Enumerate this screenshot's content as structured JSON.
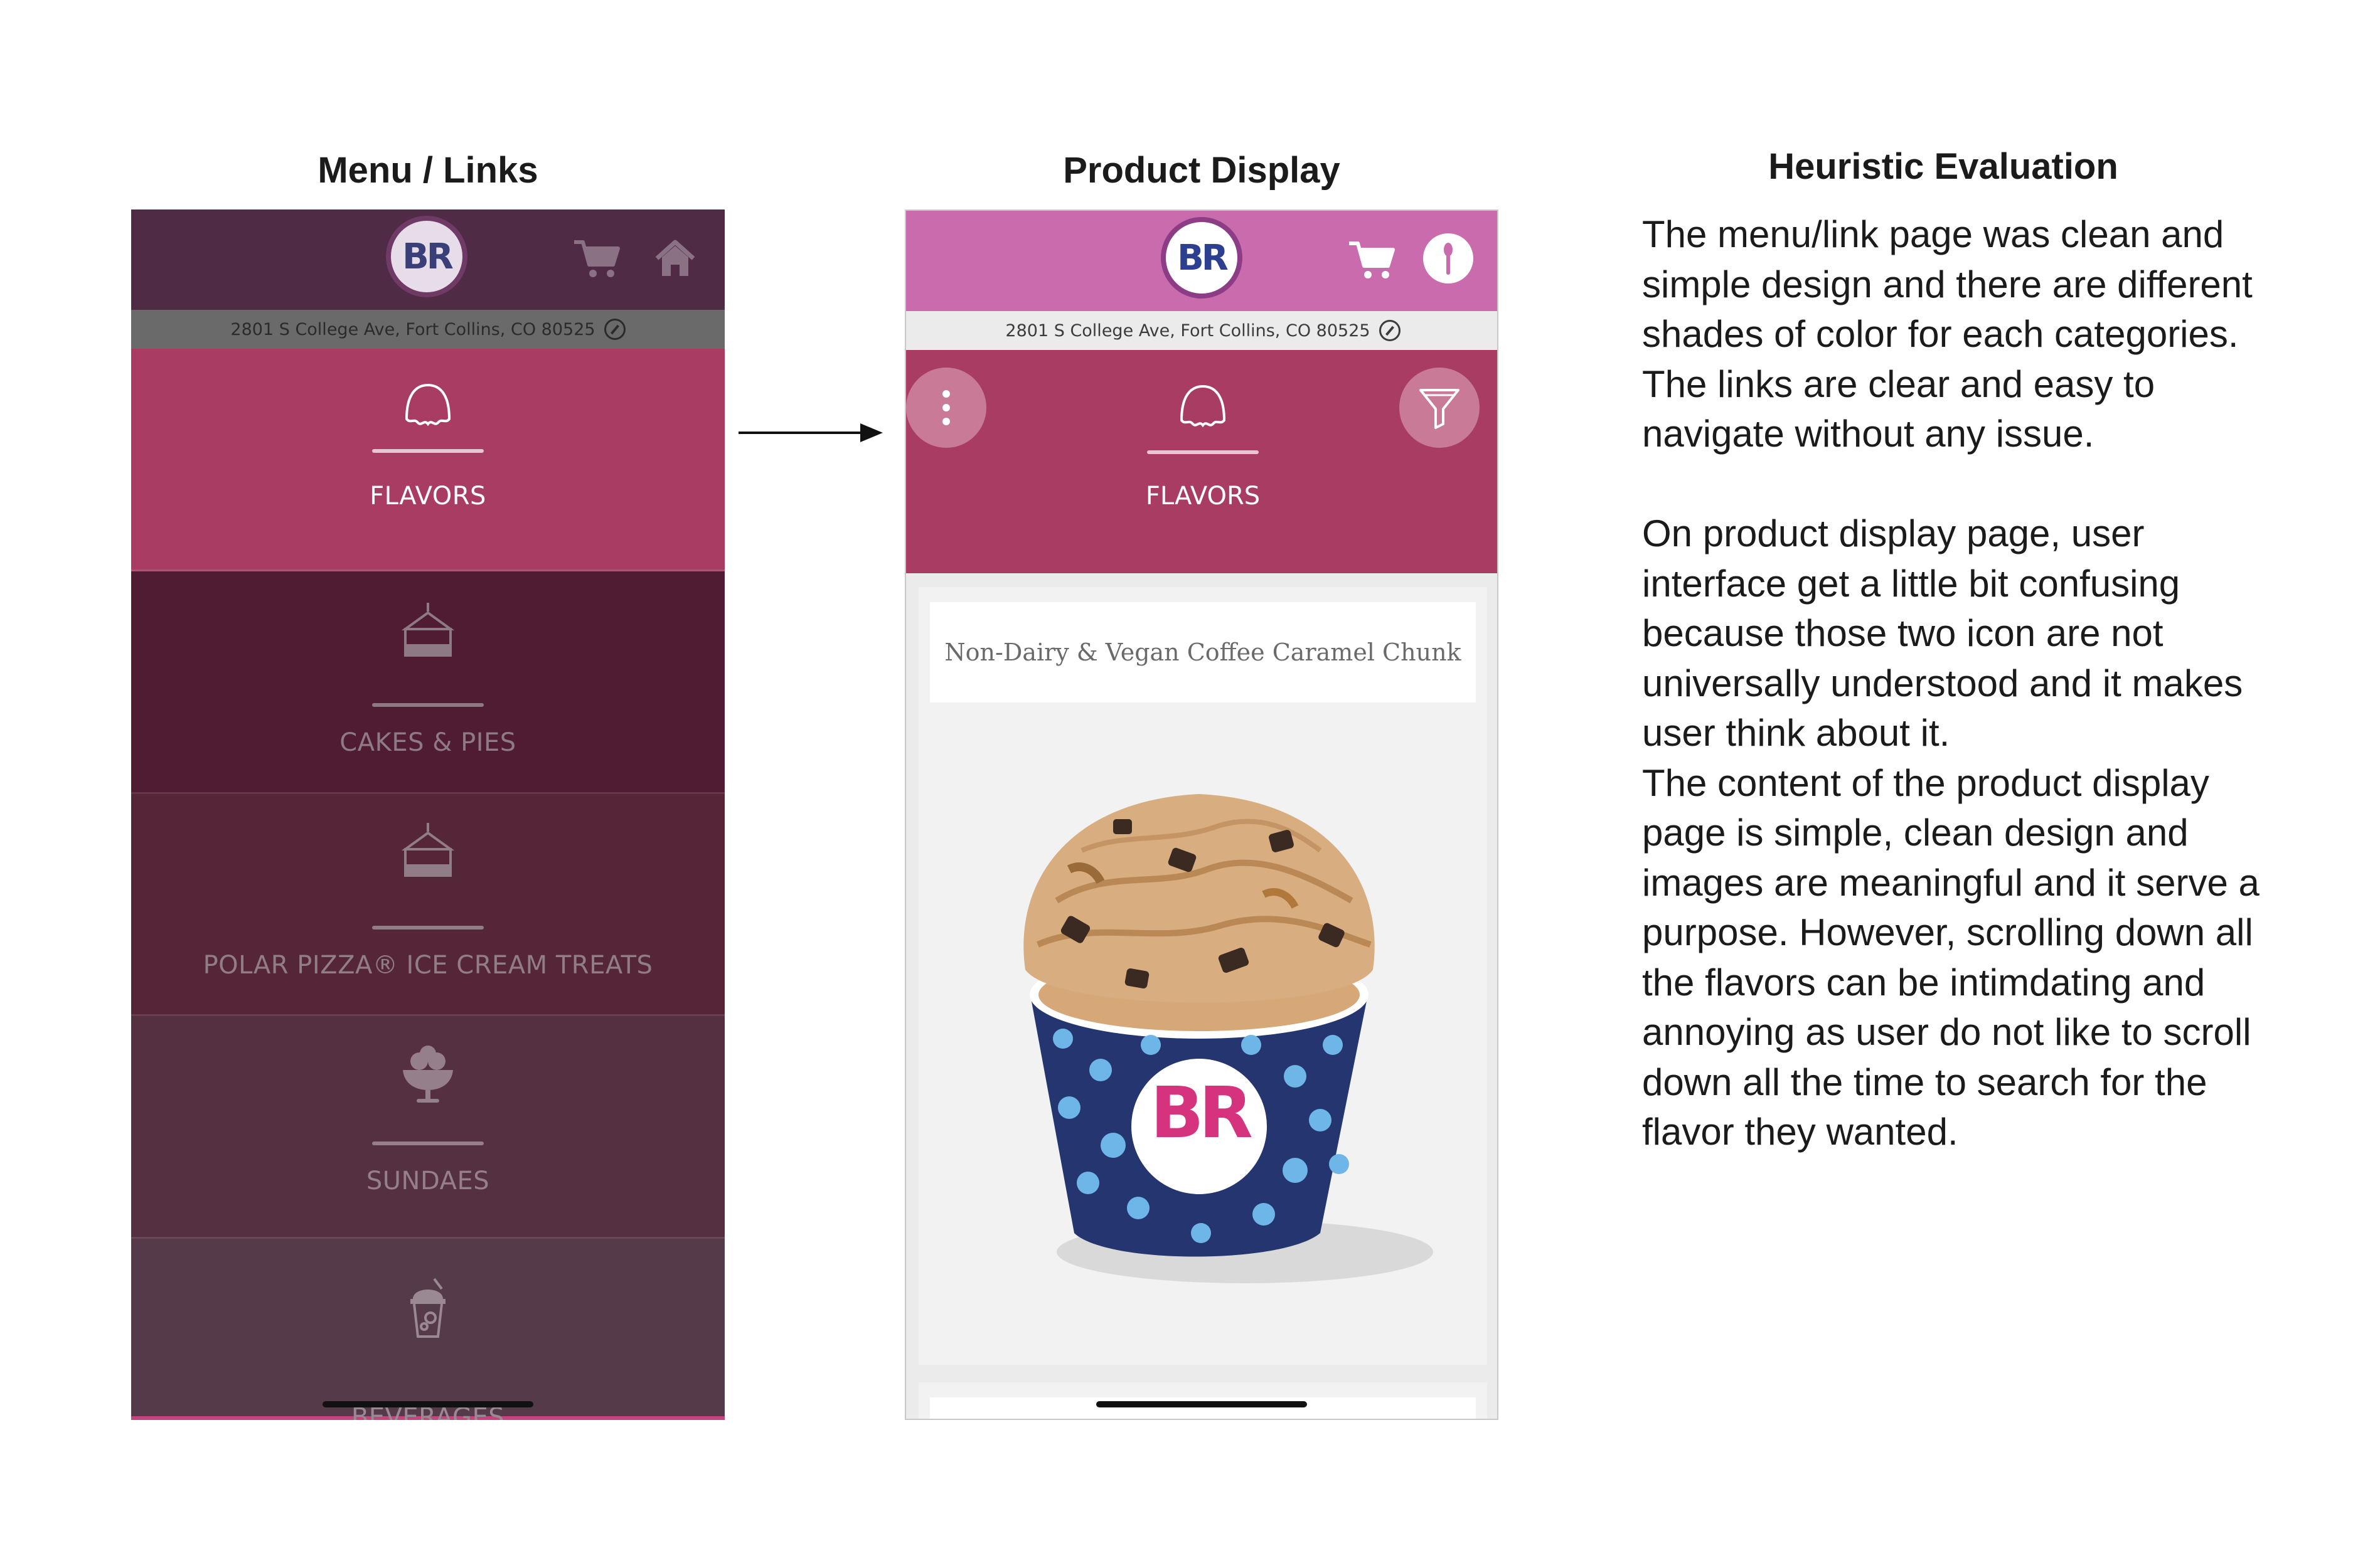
{
  "headings": {
    "menu": "Menu / Links",
    "product": "Product Display",
    "heuristic": "Heuristic Evaluation"
  },
  "shared": {
    "logo_text": "BR",
    "address": "2801 S College Ave, Fort Collins, CO 80525"
  },
  "menu_screen": {
    "tiles": [
      {
        "label": "FLAVORS",
        "icon": "ice-cream-scoop-icon",
        "color": "#a83c62"
      },
      {
        "label": "CAKES & PIES",
        "icon": "cake-slice-icon",
        "color": "#4f1c33"
      },
      {
        "label": "POLAR PIZZA® ICE CREAM TREATS",
        "icon": "pizza-slice-icon",
        "color": "#552538"
      },
      {
        "label": "SUNDAES",
        "icon": "sundae-cup-icon",
        "color": "#553041"
      },
      {
        "label": "BEVERAGES",
        "icon": "beverage-cup-icon",
        "color": "#553a4a"
      }
    ]
  },
  "product_screen": {
    "category_label": "FLAVORS",
    "product_name": "Non-Dairy & Vegan Coffee Caramel Chunk",
    "cup_logo_text": "BR"
  },
  "evaluation": {
    "paragraph1": [
      "The menu/link page was clean and",
      "simple design and there are different",
      "shades of color for each categories.",
      "The links are clear and easy to",
      "navigate without any issue."
    ],
    "paragraph2": [
      "On product display page, user",
      "interface get a little bit confusing",
      "because those two icon are not",
      "universally understood and it makes",
      "user think about it.",
      "The content of the product display",
      "page is simple, clean design and",
      "images are meaningful and it serve a",
      "purpose. However, scrolling down all",
      "the flavors can be intimdating and",
      "annoying as user do not like to scroll",
      "down all the time to search for the",
      "flavor they wanted."
    ]
  },
  "colors": {
    "menu_topbar": "#4f2b45",
    "menu_addrbar": "#6a6a6a",
    "product_topbar": "#c96bad",
    "product_addrbar": "#ebebeb",
    "product_category": "#a83c62",
    "logo_blue": "#2d3f8f",
    "logo_pink": "#d6337f"
  }
}
